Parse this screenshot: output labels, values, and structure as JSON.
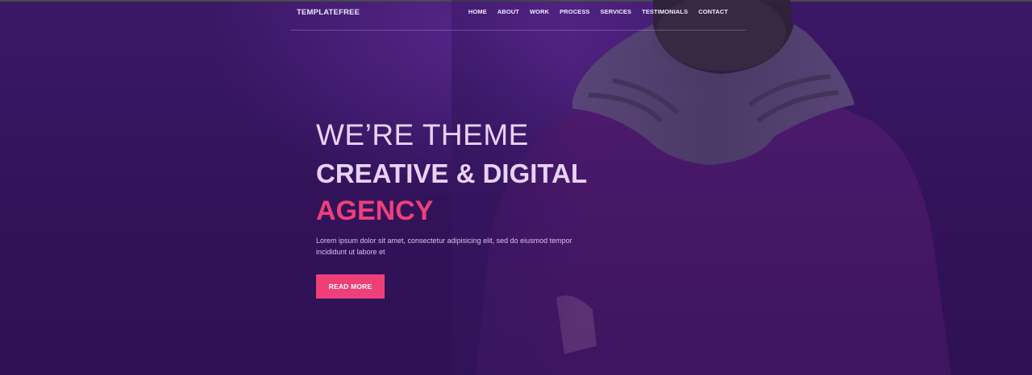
{
  "nav": {
    "brand": "TEMPLATEFREE",
    "items": [
      {
        "label": "HOME"
      },
      {
        "label": "ABOUT"
      },
      {
        "label": "WORK"
      },
      {
        "label": "PROCESS"
      },
      {
        "label": "SERVICES"
      },
      {
        "label": "TESTIMONIALS"
      },
      {
        "label": "CONTACT"
      }
    ]
  },
  "hero": {
    "line1": "WE’RE THEME",
    "line2": "CREATIVE & DIGITAL",
    "line3": "AGENCY",
    "description": "Lorem ipsum dolor sit amet, consectetur adipisicing elit, sed do eiusmod tempor incididunt ut labore et",
    "button_label": "READ MORE"
  },
  "colors": {
    "background": "#35155f",
    "accent": "#ef3f79",
    "heading_text": "#e6d3f7"
  },
  "images": {
    "hero_person": "man-with-scarf-photo"
  }
}
